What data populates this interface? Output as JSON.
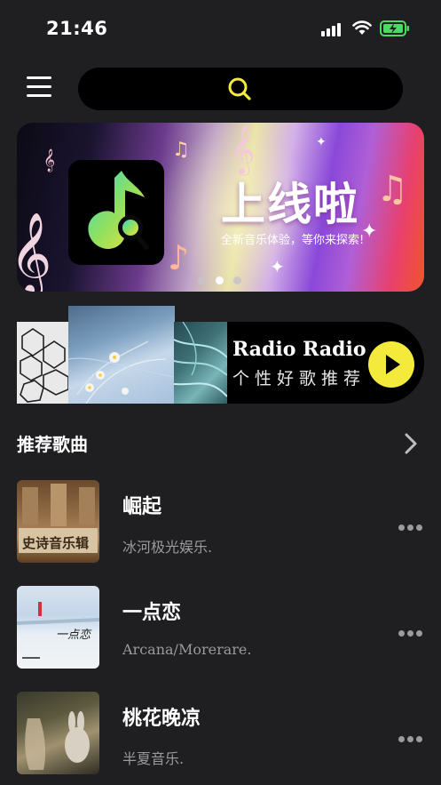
{
  "status_bar": {
    "time": "21:46"
  },
  "banner": {
    "title": "上线啦",
    "subtitle": "全新音乐体验，等你来探索!",
    "page_dots": 3,
    "active_dot": 1
  },
  "radio": {
    "title": "Radio Radio",
    "subtitle": "个性好歌推荐"
  },
  "section": {
    "title": "推荐歌曲"
  },
  "songs": [
    {
      "name": "崛起",
      "artist": "冰河极光娱乐.",
      "cover_text": "史诗音乐辑"
    },
    {
      "name": "一点恋",
      "artist": "Arcana/Morerare.",
      "cover_text": "一点恋"
    },
    {
      "name": "桃花晚凉",
      "artist": "半夏音乐."
    }
  ],
  "colors": {
    "background": "#1f1f21",
    "accent": "#f4ea3c",
    "search_icon": "#f4ea3c"
  }
}
